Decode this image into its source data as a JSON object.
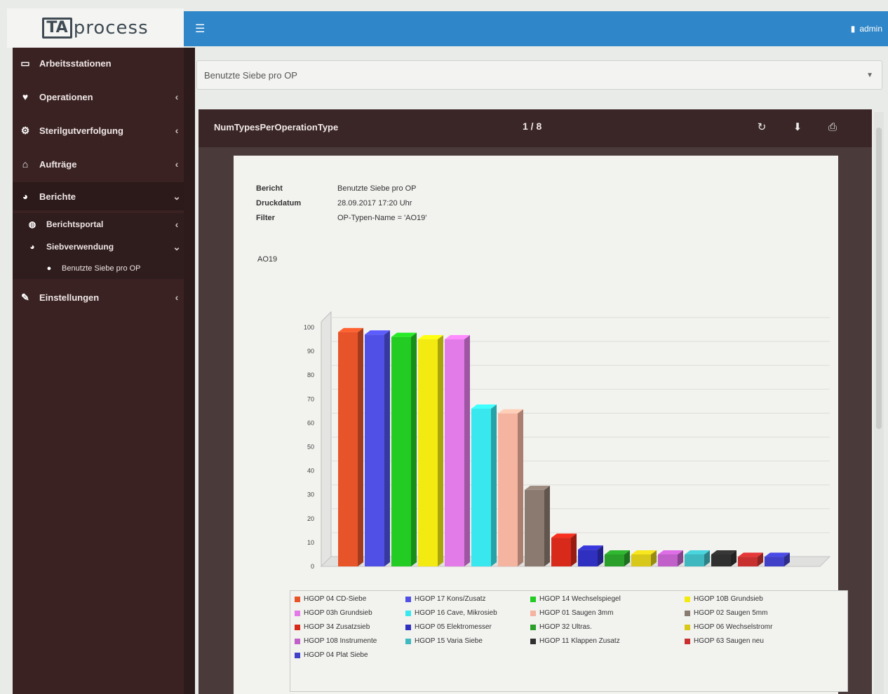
{
  "app": {
    "logo_box": "TA",
    "logo_text": "process",
    "user_label": "admin"
  },
  "sidebar": {
    "items": [
      {
        "label": "Arbeitsstationen",
        "icon": "monitor-icon",
        "chev": ""
      },
      {
        "label": "Operationen",
        "icon": "heart-icon",
        "chev": "‹"
      },
      {
        "label": "Sterilgutverfolgung",
        "icon": "cog-icon",
        "chev": "‹"
      },
      {
        "label": "Aufträge",
        "icon": "home-icon",
        "chev": "‹"
      },
      {
        "label": "Berichte",
        "icon": "chart-icon",
        "chev": "⌄"
      },
      {
        "label": "Berichtsportal",
        "icon": "globe-icon",
        "chev": "‹"
      },
      {
        "label": "Siebverwendung",
        "icon": "chart-icon",
        "chev": "⌄"
      },
      {
        "label": "Benutzte Siebe pro OP",
        "icon": "dot-icon",
        "chev": ""
      },
      {
        "label": "Einstellungen",
        "icon": "wrench-icon",
        "chev": "‹"
      }
    ]
  },
  "report_select": {
    "value": "Benutzte Siebe pro OP"
  },
  "viewer": {
    "title": "NumTypesPerOperationType",
    "page_indicator": "1 / 8"
  },
  "report_meta": [
    {
      "key": "Bericht",
      "value": "Benutzte Siebe pro OP"
    },
    {
      "key": "Druckdatum",
      "value": "28.09.2017 17:20 Uhr"
    },
    {
      "key": "Filter",
      "value": "OP-Typen-Name = 'AO19'"
    }
  ],
  "chart_heading": "AO19",
  "chart_data": {
    "type": "bar",
    "ylim": [
      0,
      100
    ],
    "yticks": [
      "0",
      "10",
      "20",
      "30",
      "40",
      "50",
      "60",
      "70",
      "80",
      "90",
      "100"
    ],
    "series": [
      {
        "name": "HGOP 04 CD-Siebe",
        "value": 98,
        "color": "#e8542a"
      },
      {
        "name": "HGOP 17 Kons/Zusatz",
        "value": 97,
        "color": "#5050e6"
      },
      {
        "name": "HGOP 14 Wechselspiegel",
        "value": 96,
        "color": "#22cc22"
      },
      {
        "name": "HGOP 10B Grundsieb",
        "value": 95,
        "color": "#f2ea10"
      },
      {
        "name": "HGOP 03h Grundsieb",
        "value": 95,
        "color": "#e27ae8"
      },
      {
        "name": "HGOP 16 Cave, Mikrosieb",
        "value": 66,
        "color": "#38e8ee"
      },
      {
        "name": "HGOP 01 Saugen 3mm",
        "value": 64,
        "color": "#f4b4a0"
      },
      {
        "name": "HGOP 02 Saugen 5mm",
        "value": 32,
        "color": "#8a7a70"
      },
      {
        "name": "HGOP 34 Zusatzsieb",
        "value": 12,
        "color": "#d82a1a"
      },
      {
        "name": "HGOP 05 Elektromesser",
        "value": 7,
        "color": "#3030c0"
      },
      {
        "name": "HGOP 32 Ultras.",
        "value": 5,
        "color": "#2aa02a"
      },
      {
        "name": "HGOP 06 Wechselstromr",
        "value": 5,
        "color": "#d8c81a"
      },
      {
        "name": "HGOP 108 Instrumente",
        "value": 5,
        "color": "#c060c8"
      },
      {
        "name": "HGOP 15 Varia Siebe",
        "value": 5,
        "color": "#40b8c0"
      },
      {
        "name": "HGOP 11 Klappen Zusatz",
        "value": 5,
        "color": "#303030"
      },
      {
        "name": "HGOP 63 Saugen neu",
        "value": 4,
        "color": "#c83030"
      },
      {
        "name": "HGOP 04 Plat Siebe",
        "value": 4,
        "color": "#4040c8"
      }
    ]
  }
}
